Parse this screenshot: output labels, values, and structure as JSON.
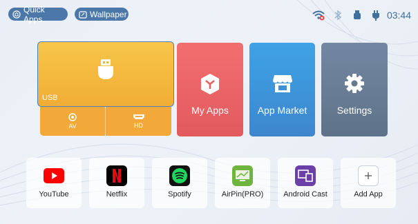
{
  "topbar": {
    "quick_apps_label": "Quick Apps",
    "wallpaper_label": "Wallpaper",
    "status_icons": [
      "wifi-disconnected-icon",
      "bluetooth-icon",
      "usb-device-icon",
      "power-plug-icon"
    ],
    "time": "03:44"
  },
  "main_tiles": {
    "usb": {
      "label": "USB",
      "icon": "usb-drive-icon",
      "color": "#f4b93f"
    },
    "av": {
      "label": "AV",
      "icon": "av-input-icon"
    },
    "hd": {
      "label": "HD",
      "icon": "hdmi-icon"
    },
    "my_apps": {
      "label": "My Apps",
      "icon": "apps-cube-icon",
      "color": "#eb6567"
    },
    "app_market": {
      "label": "App Market",
      "icon": "store-icon",
      "color": "#3e95da"
    },
    "settings": {
      "label": "Settings",
      "icon": "gear-icon",
      "color": "#687c95"
    }
  },
  "apps": [
    {
      "label": "YouTube",
      "icon": "youtube-icon",
      "color": "#ff0000"
    },
    {
      "label": "Netflix",
      "icon": "netflix-icon",
      "color": "#000000"
    },
    {
      "label": "Spotify",
      "icon": "spotify-icon",
      "color": "#000000"
    },
    {
      "label": "AirPin(PRO)",
      "icon": "airpin-icon",
      "color": "#6fb43f"
    },
    {
      "label": "Android Cast",
      "icon": "cast-icon",
      "color": "#6b3fa8"
    },
    {
      "label": "Add App",
      "icon": "plus-icon",
      "color": "#ffffff"
    }
  ]
}
